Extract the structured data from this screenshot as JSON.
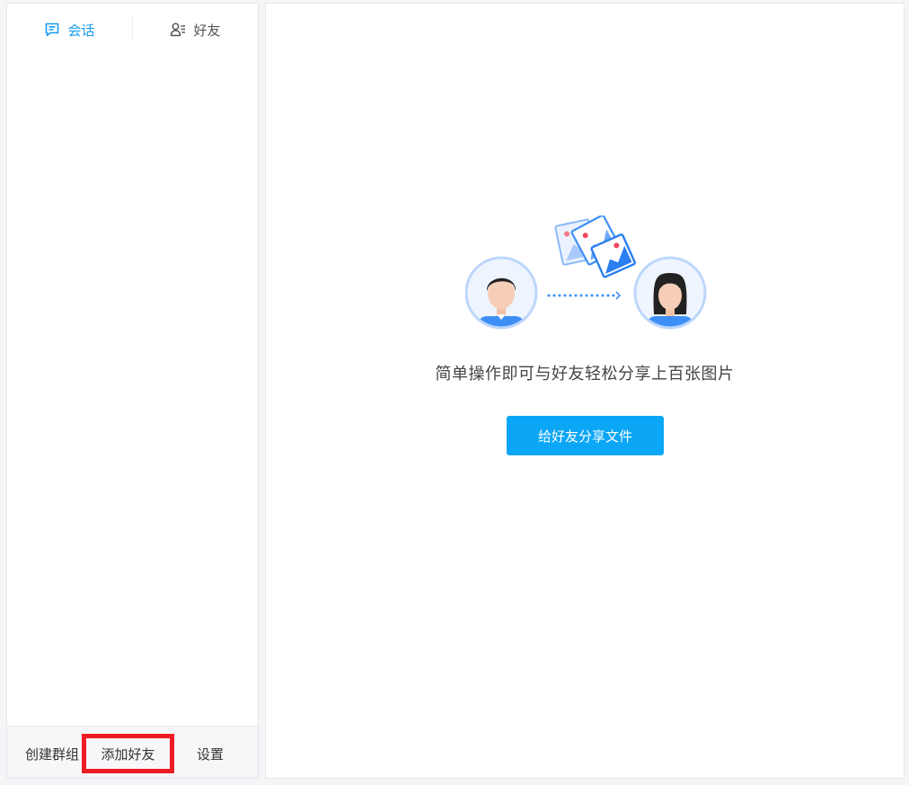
{
  "tabs": {
    "conversation_label": "会话",
    "friends_label": "好友"
  },
  "bottom_bar": {
    "create_group_label": "创建群组",
    "add_friend_label": "添加好友",
    "settings_label": "设置"
  },
  "main": {
    "share_tip": "简单操作即可与好友轻松分享上百张图片",
    "share_button_label": "给好友分享文件"
  },
  "colors": {
    "accent": "#0ba6f5",
    "active_tab": "#1a9cf0",
    "highlight_border": "#ee1c25"
  },
  "icons": [
    "chat-icon",
    "contacts-icon",
    "male-avatar-icon",
    "female-avatar-icon",
    "photos-icon",
    "dotted-arrow-icon"
  ]
}
